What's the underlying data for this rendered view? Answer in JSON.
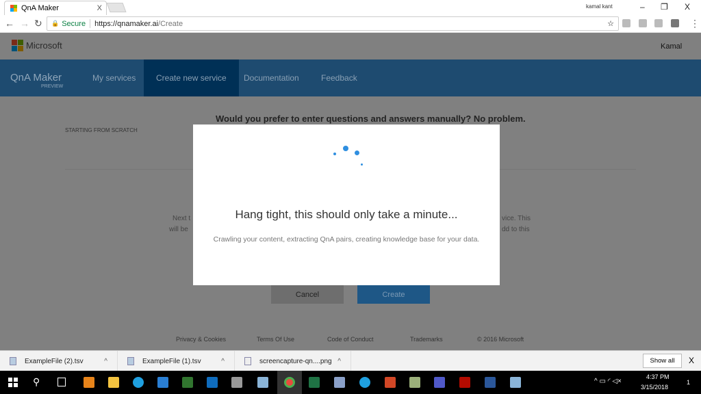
{
  "browser": {
    "tab_title": "QnA Maker",
    "tab_close": "X",
    "profile": "kamal kant",
    "url_secure": "Secure",
    "url_host": "https://qnamaker.ai",
    "url_path": "/Create",
    "min": "–",
    "restore": "❐",
    "close": "X"
  },
  "site": {
    "ms_brand": "Microsoft",
    "user": "Kamal",
    "app_name": "QnA Maker",
    "app_badge": "PREVIEW",
    "nav": [
      {
        "label": "My services"
      },
      {
        "label": "Create new service",
        "active": true
      },
      {
        "label": "Documentation"
      },
      {
        "label": "Feedback"
      }
    ]
  },
  "content": {
    "heading": "Would you prefer to enter questions and answers manually? No problem.",
    "section_label": "STARTING FROM SCRATCH",
    "partial_left_1": "Next t",
    "partial_left_2": "will be",
    "partial_right_1": "vice. This",
    "partial_right_2": "dd to this",
    "cancel": "Cancel",
    "create": "Create"
  },
  "modal": {
    "title": "Hang tight, this should only take a minute...",
    "message": "Crawling your content, extracting QnA pairs, creating knowledge base for your data.",
    "accent": "#2f8fe0"
  },
  "footer": [
    "Privacy & Cookies",
    "Terms Of Use",
    "Code of Conduct",
    "Trademarks",
    "© 2016 Microsoft"
  ],
  "downloads": {
    "items": [
      "ExampleFile (2).tsv",
      "ExampleFile (1).tsv",
      "screencapture-qn....png"
    ],
    "show_all": "Show all",
    "close": "X"
  },
  "taskbar": {
    "time": "4:37 PM",
    "date": "3/15/2018",
    "notifications": "1"
  }
}
